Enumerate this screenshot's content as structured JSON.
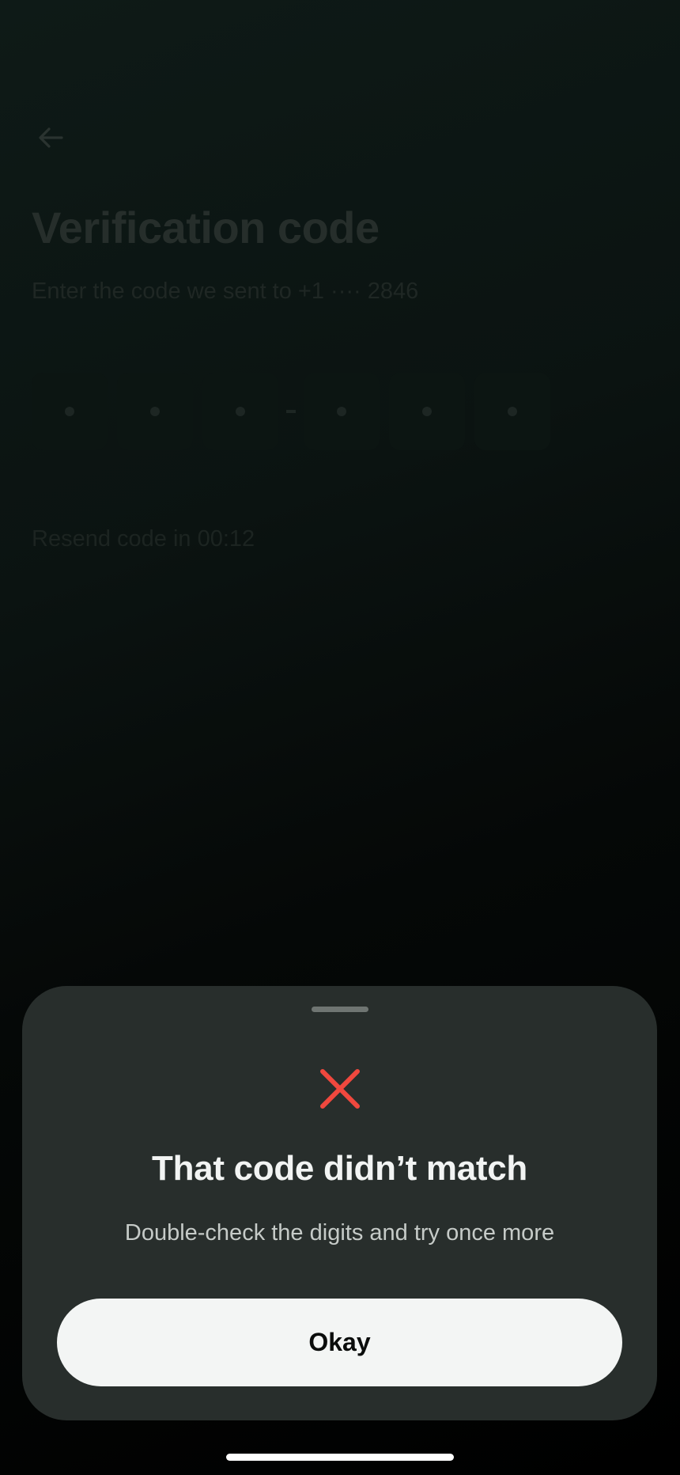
{
  "header": {
    "back_icon": "arrow-left-icon",
    "title": "Verification code",
    "subtitle": "Enter the code we sent to +1 ···· 2846"
  },
  "code_input": {
    "group1": [
      "",
      "",
      ""
    ],
    "group2": [
      "",
      "",
      ""
    ]
  },
  "resend": {
    "label": "Resend code in 00:12"
  },
  "error_sheet": {
    "icon": "x-mark-icon",
    "icon_color": "#f0483e",
    "title": "That code didn’t match",
    "message": "Double-check the digits and try once more",
    "button_label": "Okay"
  },
  "colors": {
    "sheet_background": "#282e2c",
    "button_background": "#f3f5f4"
  }
}
